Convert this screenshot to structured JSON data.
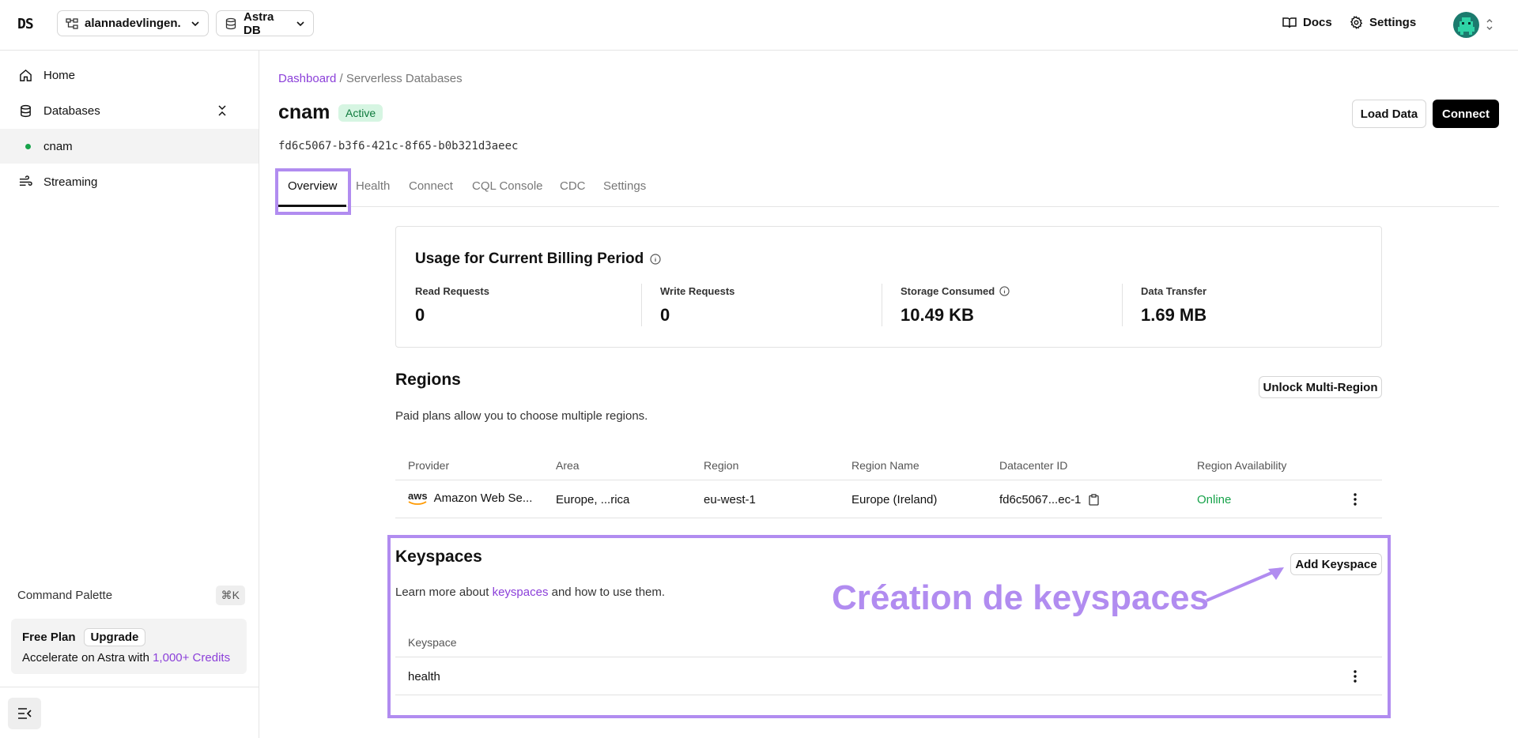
{
  "topbar": {
    "logo": "DS",
    "org_name": "alannadevlingen...",
    "product": "Astra DB",
    "docs_label": "Docs",
    "settings_label": "Settings"
  },
  "sidebar": {
    "items": [
      {
        "label": "Home",
        "icon": "home-icon"
      },
      {
        "label": "Databases",
        "icon": "database-icon"
      },
      {
        "label": "cnam",
        "status_color": "#17a34a"
      },
      {
        "label": "Streaming",
        "icon": "streaming-icon"
      }
    ],
    "command_palette": "Command Palette",
    "shortcut": "⌘K",
    "plan": {
      "name": "Free Plan",
      "upgrade": "Upgrade",
      "text": "Accelerate on Astra with ",
      "credits_link": "1,000+ Credits"
    }
  },
  "page": {
    "breadcrumb_link": "Dashboard",
    "breadcrumb_rest": " / Serverless Databases",
    "title": "cnam",
    "status": "Active",
    "database_id": "fd6c5067-b3f6-421c-8f65-b0b321d3aeec",
    "load_data": "Load Data",
    "connect": "Connect",
    "tabs": [
      "Overview",
      "Health",
      "Connect",
      "CQL Console",
      "CDC",
      "Settings"
    ],
    "active_tab": "Overview"
  },
  "usage": {
    "title": "Usage for Current Billing Period",
    "metrics": [
      {
        "label": "Read Requests",
        "value": "0"
      },
      {
        "label": "Write Requests",
        "value": "0"
      },
      {
        "label": "Storage Consumed",
        "value": "10.49 KB"
      },
      {
        "label": "Data Transfer",
        "value": "1.69 MB"
      }
    ]
  },
  "regions": {
    "title": "Regions",
    "subtitle": "Paid plans allow you to choose multiple regions.",
    "unlock_button": "Unlock Multi-Region",
    "columns": [
      "Provider",
      "Area",
      "Region",
      "Region Name",
      "Datacenter ID",
      "Region Availability"
    ],
    "rows": [
      {
        "provider_logo": "aws",
        "provider": "Amazon Web Se...",
        "area": "Europe, ...rica",
        "region": "eu-west-1",
        "region_name": "Europe (Ireland)",
        "datacenter_id": "fd6c5067...ec-1",
        "availability": "Online"
      }
    ]
  },
  "keyspaces": {
    "title": "Keyspaces",
    "subtitle_before": "Learn more about ",
    "subtitle_link": "keyspaces",
    "subtitle_after": " and how to use them.",
    "add_button": "Add Keyspace",
    "column": "Keyspace",
    "rows": [
      "health"
    ]
  },
  "annotation": {
    "text": "Création de keyspaces",
    "color": "#b18cf0"
  }
}
